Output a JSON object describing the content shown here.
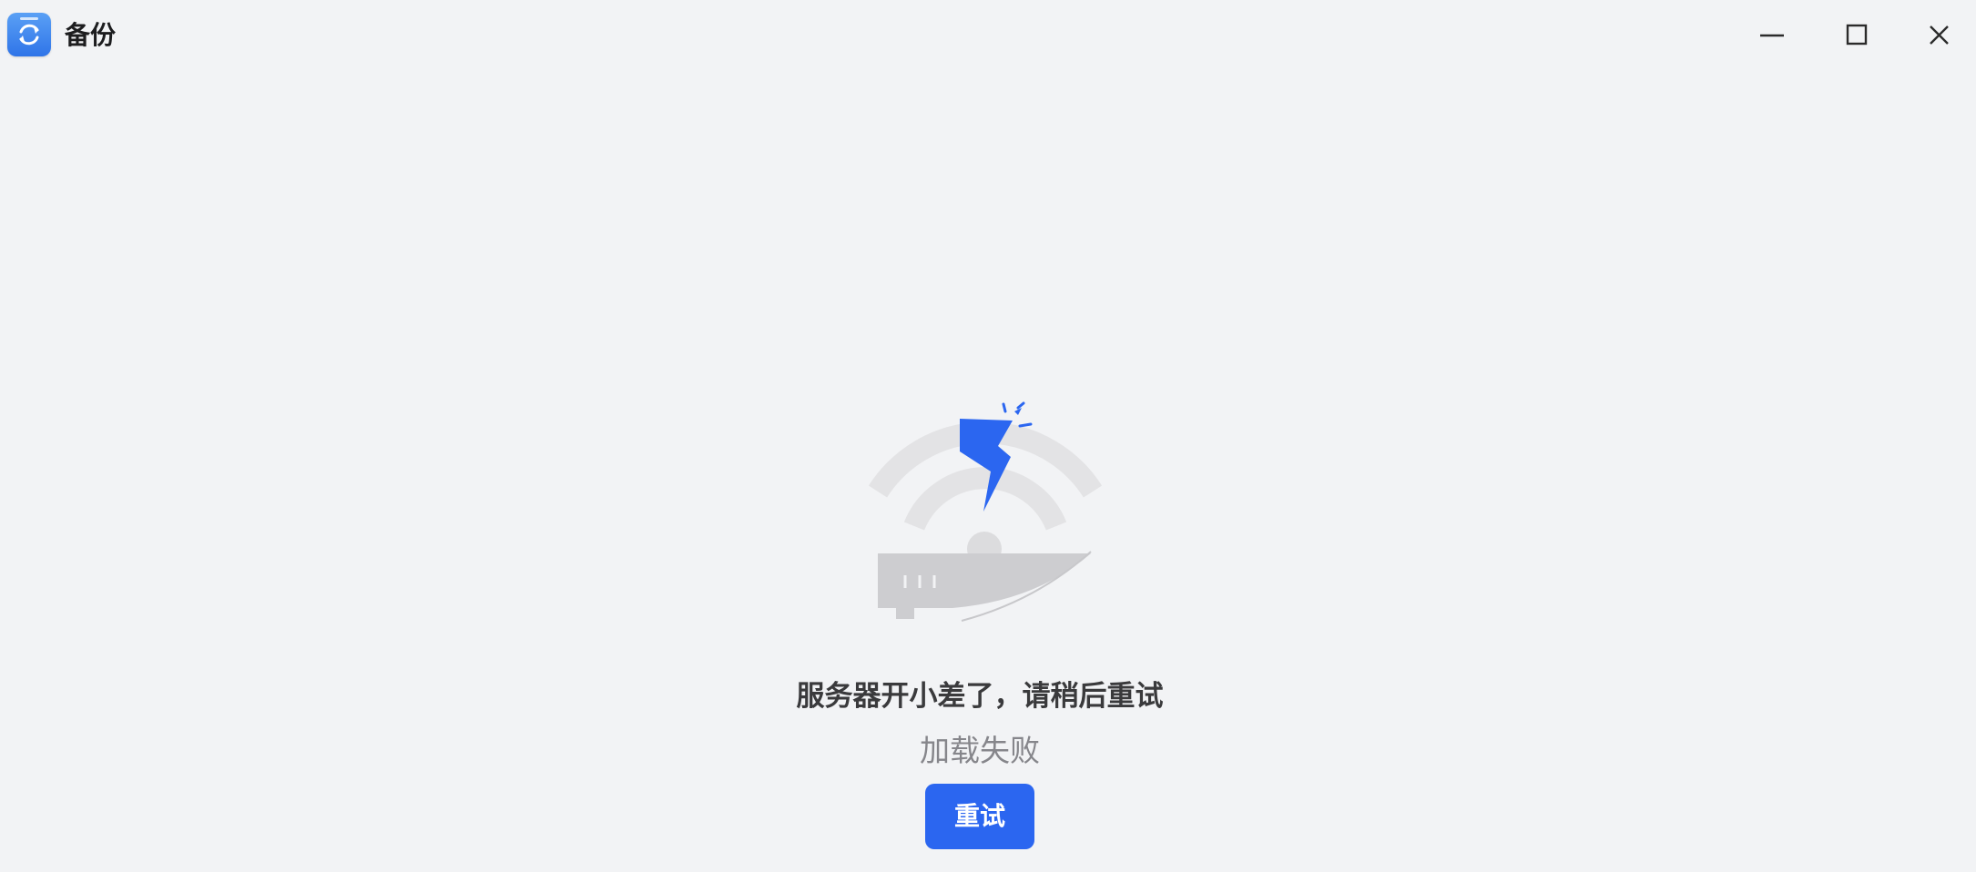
{
  "window": {
    "title": "备份",
    "app_icon": "sync-icon",
    "controls": {
      "minimize_icon": "minimize-icon",
      "maximize_icon": "maximize-icon",
      "close_icon": "close-icon"
    }
  },
  "empty_state": {
    "illustration": "wifi-router-lightning-illustration",
    "title": "服务器开小差了，请稍后重试",
    "subtitle": "加载失败",
    "retry_label": "重试"
  },
  "colors": {
    "background": "#f2f3f5",
    "accent": "#2b66f0",
    "title_text": "#3a3a3c",
    "subtitle_text": "#86868b",
    "illustration_gray": "#d9d9db"
  }
}
